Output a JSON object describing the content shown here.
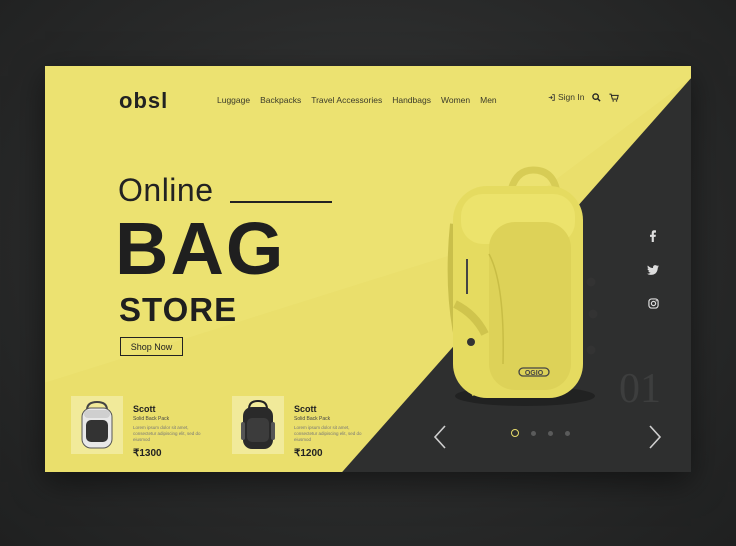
{
  "brand": {
    "logo": "obsl"
  },
  "nav": {
    "items": [
      "Luggage",
      "Backpacks",
      "Travel Accessories",
      "Handbags",
      "Women",
      "Men"
    ],
    "signin": "Sign In"
  },
  "hero": {
    "line1": "Online",
    "line2": "BAG",
    "line3": "STORE",
    "cta": "Shop Now"
  },
  "products": [
    {
      "name": "Scott",
      "type": "Solid Back Pack",
      "desc": "Lorem ipsum dolor sit amet, consectetur adipiscing elit, sed do eiusmod",
      "price": "₹1300"
    },
    {
      "name": "Scott",
      "type": "Solid Back Pack",
      "desc": "Lorem ipsum dolor sit amet, consectetur adipiscing elit, sed do eiusmod",
      "price": "₹1200"
    }
  ],
  "featured": {
    "brand_mark": "OGIO"
  },
  "slider": {
    "number": "01",
    "total_dots": 4,
    "active_dot": 1
  },
  "colors": {
    "accent": "#eadf6c",
    "dark": "#2e2f2f"
  }
}
